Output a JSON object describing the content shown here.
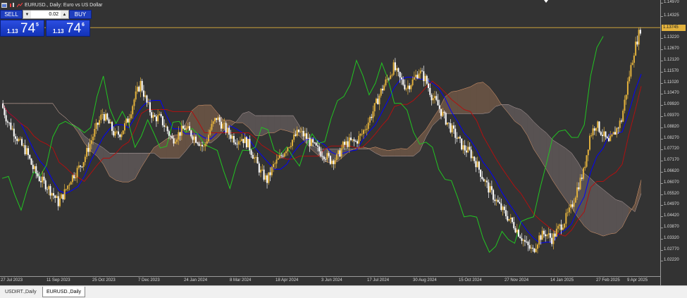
{
  "window": {
    "title": "EURUSD., Daily:  Euro vs US Dollar"
  },
  "trade_panel": {
    "sell_label": "SELL",
    "buy_label": "BUY",
    "lot_value": "0.02",
    "sell_price": {
      "small": "1.13",
      "big": "74",
      "sup": "5"
    },
    "buy_price": {
      "small": "1.13",
      "big": "74",
      "sup": "6"
    },
    "down_arrow": "▼",
    "up_arrow": "▲"
  },
  "price_axis": {
    "labels": [
      "1.14970",
      "1.14325",
      "1.13745",
      "1.13220",
      "1.12670",
      "1.12120",
      "1.11570",
      "1.11020",
      "1.10470",
      "1.09920",
      "1.09370",
      "1.08820",
      "1.08270",
      "1.07720",
      "1.07170",
      "1.06620",
      "1.06070",
      "1.05520",
      "1.04970",
      "1.04420",
      "1.03870",
      "1.03320",
      "1.02770",
      "1.02220"
    ],
    "current_price": "1.13745"
  },
  "time_axis": {
    "labels": [
      "27 Jul 2023",
      "11 Sep 2023",
      "25 Oct 2023",
      "7 Dec 2023",
      "24 Jan 2024",
      "8 Mar 2024",
      "18 Apr 2024",
      "3 Jun 2024",
      "17 Jul 2024",
      "30 Aug 2024",
      "15 Oct 2024",
      "27 Nov 2024",
      "14 Jan 2025",
      "27 Feb 2025",
      "9 Apr 2025"
    ]
  },
  "tabs": [
    {
      "label": "USDIRT.,Daily"
    },
    {
      "label": "EURUSD.,Daily"
    }
  ],
  "colors": {
    "background": "#333333",
    "candle_up": "#e2b13c",
    "candle_down": "#ffffff",
    "tenkan": "#0000ff",
    "kijun": "#b01010",
    "chikou": "#22c422",
    "cloud_up": "#e8a070",
    "cloud_down": "#bba7a7",
    "price_line": "#e2b13c"
  },
  "chart_data": {
    "type": "candlestick",
    "symbol": "EURUSD.",
    "timeframe": "Daily",
    "indicator": "Ichimoku Kinko Hyo",
    "current_price": 1.13745,
    "ylim": [
      1.0168,
      1.1497
    ],
    "x": [
      "27 Jul 2023",
      "11 Sep 2023",
      "25 Oct 2023",
      "7 Dec 2023",
      "24 Jan 2024",
      "8 Mar 2024",
      "18 Apr 2024",
      "3 Jun 2024",
      "17 Jul 2024",
      "30 Aug 2024",
      "15 Oct 2024",
      "27 Nov 2024",
      "14 Jan 2025",
      "27 Feb 2025",
      "9 Apr 2025"
    ],
    "close_path": [
      [
        0,
        1.1
      ],
      [
        1,
        1.091
      ],
      [
        2,
        1.086
      ],
      [
        3,
        1.08
      ],
      [
        4,
        1.076
      ],
      [
        5,
        1.068
      ],
      [
        6,
        1.063
      ],
      [
        7,
        1.06
      ],
      [
        8,
        1.056
      ],
      [
        9,
        1.051
      ],
      [
        10,
        1.056
      ],
      [
        11,
        1.063
      ],
      [
        12,
        1.067
      ],
      [
        13,
        1.072
      ],
      [
        14,
        1.08
      ],
      [
        15,
        1.088
      ],
      [
        16,
        1.095
      ],
      [
        17,
        1.09
      ],
      [
        18,
        1.084
      ],
      [
        19,
        1.086
      ],
      [
        20,
        1.092
      ],
      [
        21,
        1.102
      ],
      [
        22,
        1.11
      ],
      [
        23,
        1.1
      ],
      [
        24,
        1.093
      ],
      [
        25,
        1.093
      ],
      [
        26,
        1.088
      ],
      [
        27,
        1.082
      ],
      [
        28,
        1.085
      ],
      [
        29,
        1.088
      ],
      [
        30,
        1.085
      ],
      [
        31,
        1.082
      ],
      [
        32,
        1.078
      ],
      [
        33,
        1.087
      ],
      [
        34,
        1.093
      ],
      [
        35,
        1.089
      ],
      [
        36,
        1.085
      ],
      [
        37,
        1.082
      ],
      [
        38,
        1.083
      ],
      [
        39,
        1.08
      ],
      [
        40,
        1.073
      ],
      [
        41,
        1.066
      ],
      [
        42,
        1.062
      ],
      [
        43,
        1.069
      ],
      [
        44,
        1.073
      ],
      [
        45,
        1.078
      ],
      [
        46,
        1.082
      ],
      [
        47,
        1.086
      ],
      [
        48,
        1.084
      ],
      [
        49,
        1.08
      ],
      [
        50,
        1.077
      ],
      [
        51,
        1.075
      ],
      [
        52,
        1.072
      ],
      [
        53,
        1.073
      ],
      [
        54,
        1.079
      ],
      [
        55,
        1.081
      ],
      [
        56,
        1.081
      ],
      [
        57,
        1.085
      ],
      [
        58,
        1.091
      ],
      [
        59,
        1.098
      ],
      [
        60,
        1.106
      ],
      [
        61,
        1.112
      ],
      [
        62,
        1.118
      ],
      [
        63,
        1.112
      ],
      [
        64,
        1.108
      ],
      [
        65,
        1.111
      ],
      [
        66,
        1.116
      ],
      [
        67,
        1.112
      ],
      [
        68,
        1.104
      ],
      [
        69,
        1.099
      ],
      [
        70,
        1.093
      ],
      [
        71,
        1.088
      ],
      [
        72,
        1.083
      ],
      [
        73,
        1.078
      ],
      [
        74,
        1.076
      ],
      [
        75,
        1.071
      ],
      [
        76,
        1.064
      ],
      [
        77,
        1.058
      ],
      [
        78,
        1.053
      ],
      [
        79,
        1.048
      ],
      [
        80,
        1.044
      ],
      [
        81,
        1.04
      ],
      [
        82,
        1.035
      ],
      [
        83,
        1.03
      ],
      [
        84,
        1.027
      ],
      [
        85,
        1.034
      ],
      [
        86,
        1.036
      ],
      [
        87,
        1.033
      ],
      [
        88,
        1.038
      ],
      [
        89,
        1.042
      ],
      [
        90,
        1.048
      ],
      [
        91,
        1.058
      ],
      [
        92,
        1.066
      ],
      [
        93,
        1.084
      ],
      [
        94,
        1.09
      ],
      [
        95,
        1.085
      ],
      [
        96,
        1.08
      ],
      [
        97,
        1.086
      ],
      [
        98,
        1.092
      ],
      [
        99,
        1.11
      ],
      [
        100,
        1.126
      ],
      [
        101,
        1.137
      ]
    ]
  }
}
